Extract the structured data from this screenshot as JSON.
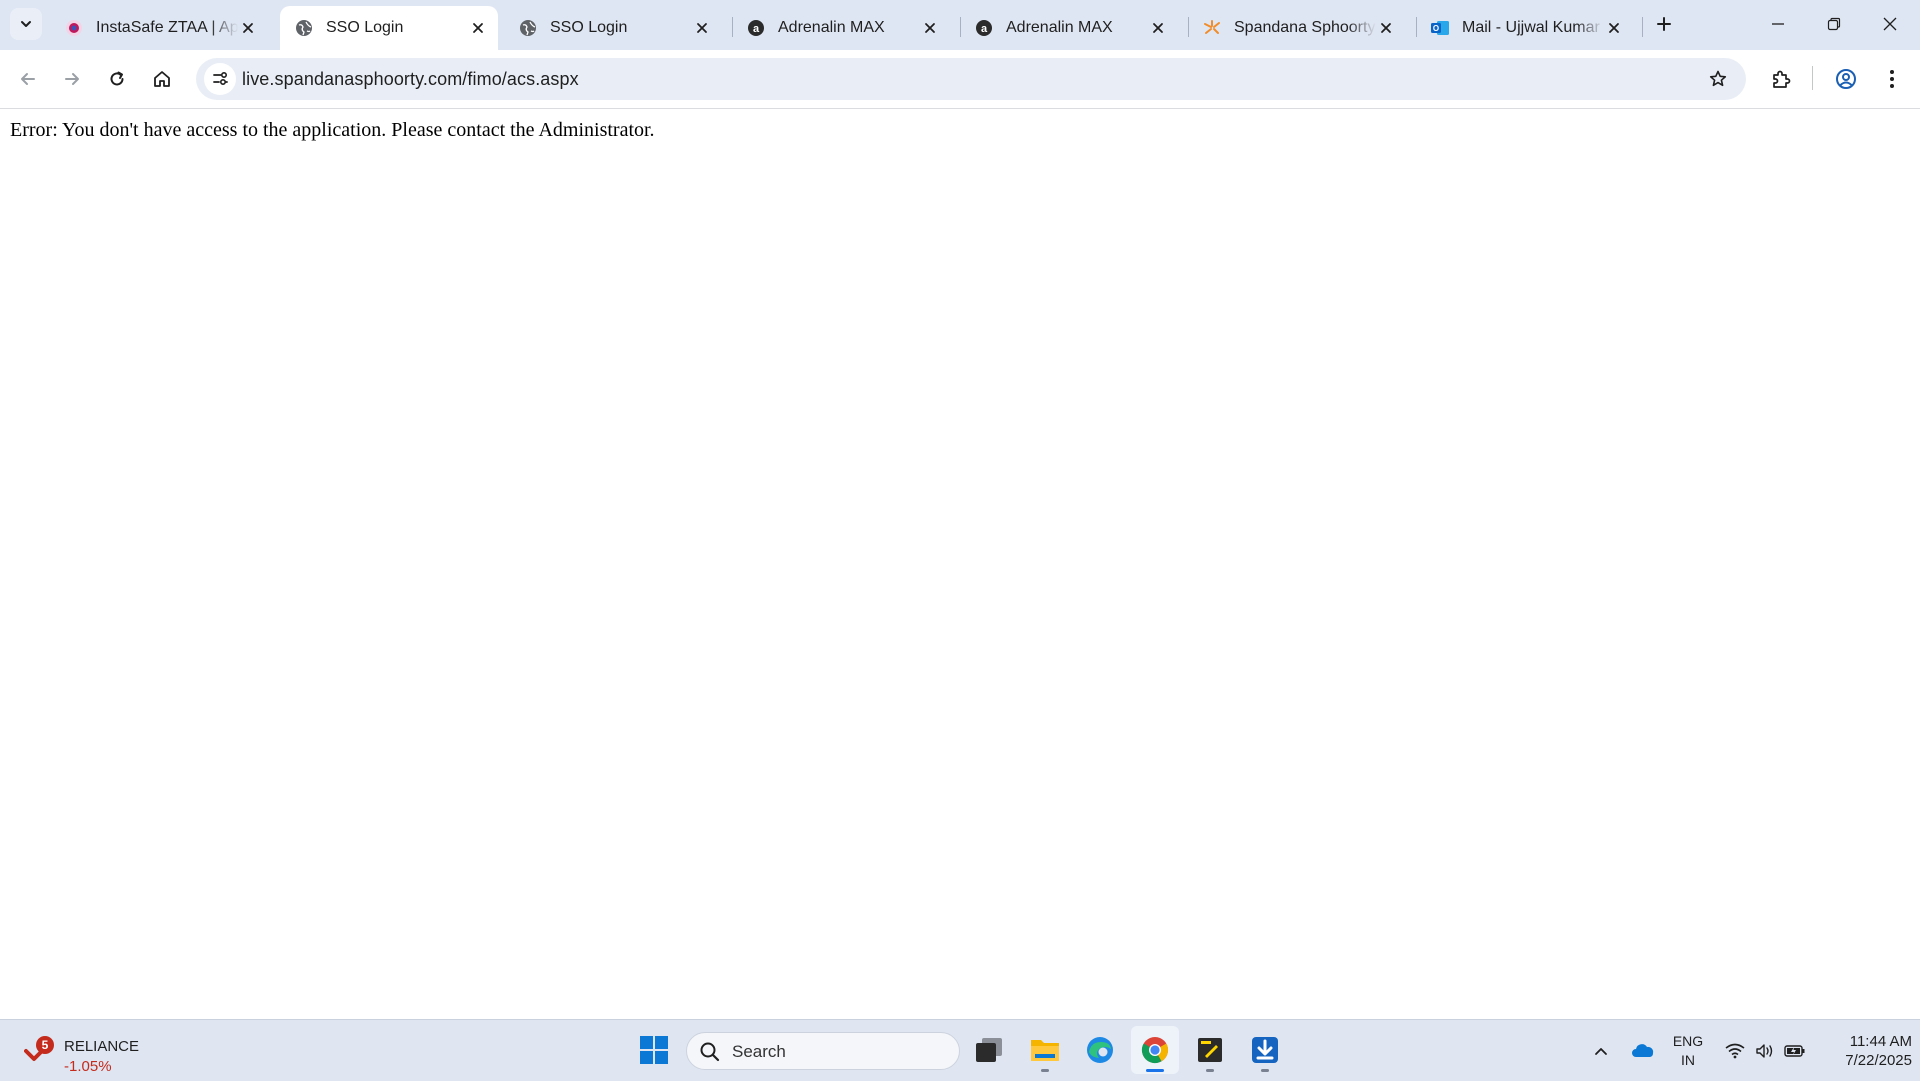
{
  "tabs": [
    {
      "title": "InstaSafe ZTAA | App",
      "favicon": "instasafe-icon",
      "active": false
    },
    {
      "title": "SSO Login",
      "favicon": "globe-icon",
      "active": true
    },
    {
      "title": "SSO Login",
      "favicon": "globe-icon",
      "active": false
    },
    {
      "title": "Adrenalin MAX",
      "favicon": "adrenalin-icon",
      "active": false
    },
    {
      "title": "Adrenalin MAX",
      "favicon": "adrenalin-icon",
      "active": false
    },
    {
      "title": "Spandana Sphoorty",
      "favicon": "spandana-icon",
      "active": false
    },
    {
      "title": "Mail - Ujjwal Kumar",
      "favicon": "outlook-icon",
      "active": false
    }
  ],
  "address_bar": {
    "url": "live.spandanasphoorty.com/fimo/acs.aspx"
  },
  "page": {
    "error_message": "Error: You don't have access to the application. Please contact the Administrator."
  },
  "taskbar": {
    "stock": {
      "name": "RELIANCE",
      "change": "-1.05%",
      "badge": "5"
    },
    "search_placeholder": "Search",
    "apps": [
      "start-icon",
      "task-view-icon",
      "file-explorer-icon",
      "edge-icon",
      "chrome-icon",
      "sticky-notes-icon",
      "downloader-icon"
    ],
    "language": {
      "line1": "ENG",
      "line2": "IN"
    },
    "clock": {
      "time": "11:44 AM",
      "date": "7/22/2025"
    }
  },
  "colors": {
    "tabstrip_bg": "#dfe6f3",
    "taskbar_bg": "#dfe6f2",
    "omnibox_bg": "#e9eef6",
    "accent": "#1a73e8",
    "stock_negative": "#c42b1c"
  }
}
